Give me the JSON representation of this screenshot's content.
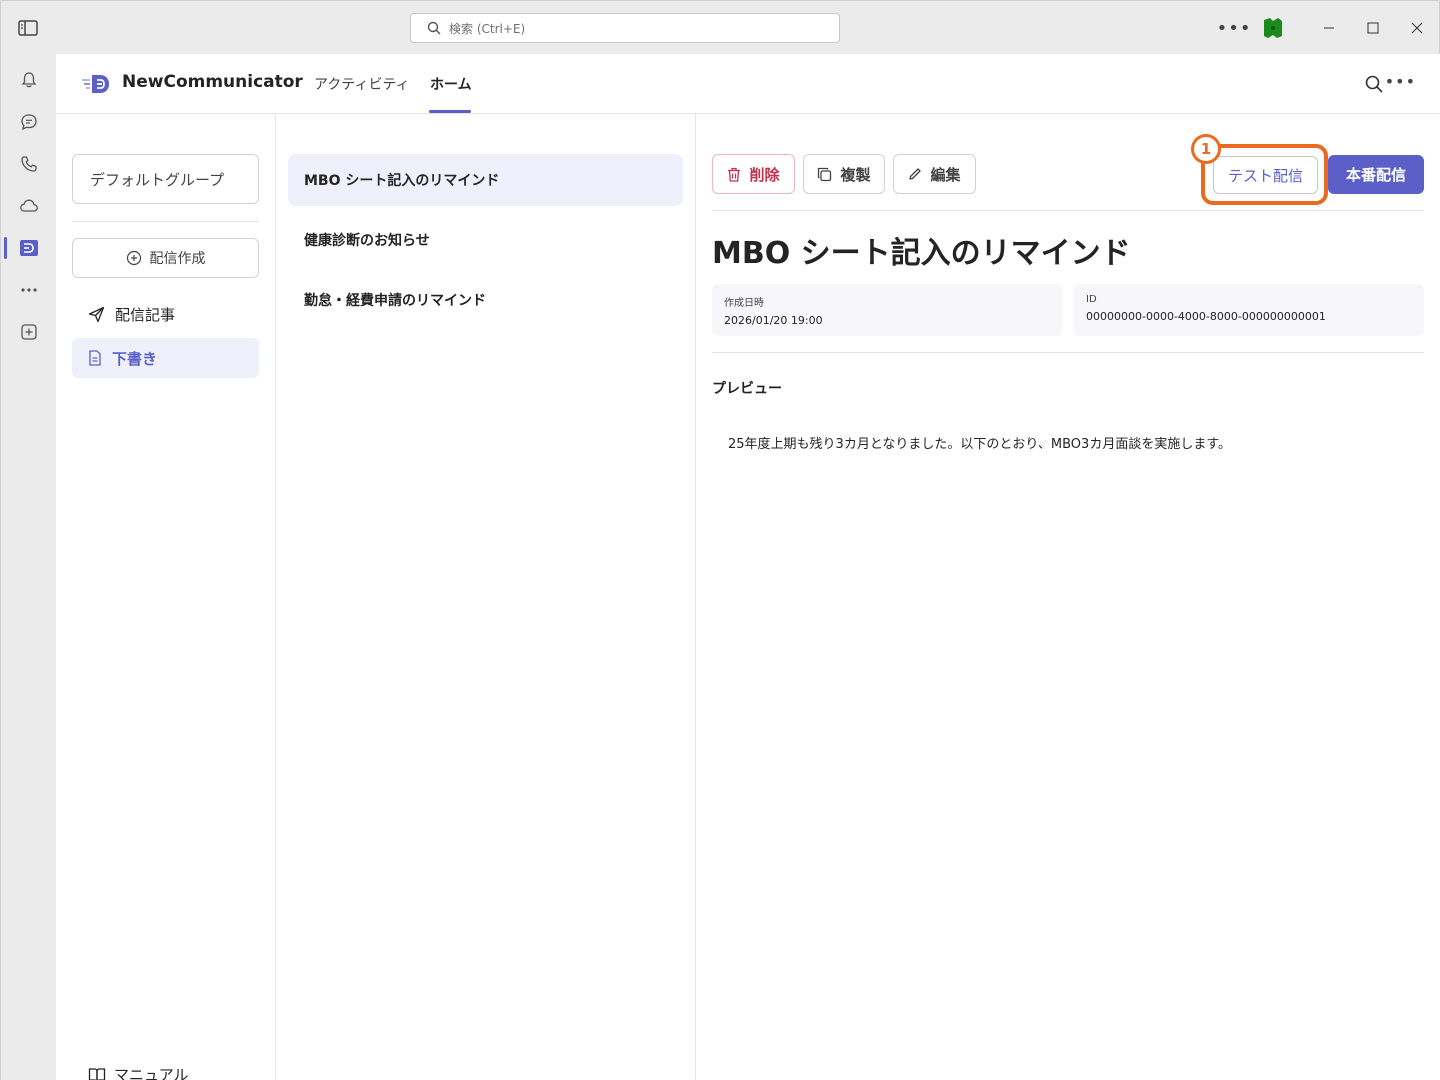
{
  "titlebar": {
    "search_placeholder": "検索 (Ctrl+E)"
  },
  "rail": {
    "items": [
      "notifications-icon",
      "chat-icon",
      "calls-icon",
      "cloud-icon",
      "newcommunicator-app-icon",
      "more-apps-icon",
      "add-app-icon"
    ]
  },
  "app": {
    "name": "NewCommunicator",
    "tabs": [
      {
        "label": "アクティビティ"
      },
      {
        "label": "ホーム",
        "active": true
      }
    ]
  },
  "left": {
    "group": "デフォルトグループ",
    "create_label": "配信作成",
    "nav": [
      {
        "label": "配信記事"
      },
      {
        "label": "下書き",
        "active": true
      }
    ],
    "manual_label": "マニュアル"
  },
  "list": {
    "items": [
      {
        "title": "MBO シート記入のリマインド",
        "selected": true
      },
      {
        "title": "健康診断のお知らせ"
      },
      {
        "title": "勤怠・経費申請のリマインド"
      }
    ]
  },
  "detail": {
    "delete_label": "削除",
    "copy_label": "複製",
    "edit_label": "編集",
    "test_label": "テスト配信",
    "badge": "1",
    "prod_label": "本番配信",
    "title": "MBO シート記入のリマインド",
    "created_label": "作成日時",
    "created_value": "2026/01/20 19:00",
    "id_label": "ID",
    "id_value": "00000000-0000-4000-8000-000000000001",
    "preview_label": "プレビュー",
    "preview_text": "25年度上期も残り3カ月となりました。以下のとおり、MBO3カ月面談を実施します。"
  },
  "colors": {
    "accent": "#5b5fc7",
    "highlight": "#ea6a1f",
    "danger": "#c4314b"
  }
}
